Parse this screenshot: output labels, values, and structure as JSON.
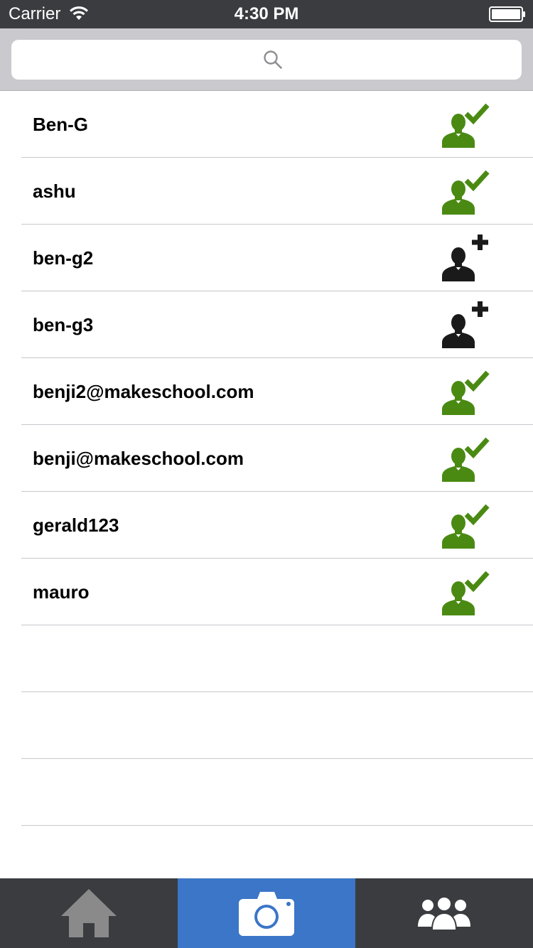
{
  "status_bar": {
    "carrier": "Carrier",
    "time": "4:30 PM"
  },
  "search": {
    "placeholder": "",
    "value": ""
  },
  "friends": [
    {
      "name": "Ben-G",
      "status": "following"
    },
    {
      "name": "ashu",
      "status": "following"
    },
    {
      "name": "ben-g2",
      "status": "add"
    },
    {
      "name": "ben-g3",
      "status": "add"
    },
    {
      "name": "benji2@makeschool.com",
      "status": "following"
    },
    {
      "name": "benji@makeschool.com",
      "status": "following"
    },
    {
      "name": "gerald123",
      "status": "following"
    },
    {
      "name": "mauro",
      "status": "following"
    }
  ],
  "empty_rows": 3,
  "tab_bar": {
    "tabs": [
      {
        "name": "home",
        "icon": "home-icon",
        "selected": false
      },
      {
        "name": "camera",
        "icon": "camera-icon",
        "selected": true
      },
      {
        "name": "friends",
        "icon": "friends-icon",
        "selected": false
      }
    ]
  },
  "colors": {
    "status_bar_bg": "#3a3c40",
    "search_area_bg": "#c9c9ce",
    "following_green": "#4a8a12",
    "add_black": "#1a1a1a",
    "tab_selected": "#3b76c8",
    "tab_bar_bg": "#3a3c40"
  }
}
